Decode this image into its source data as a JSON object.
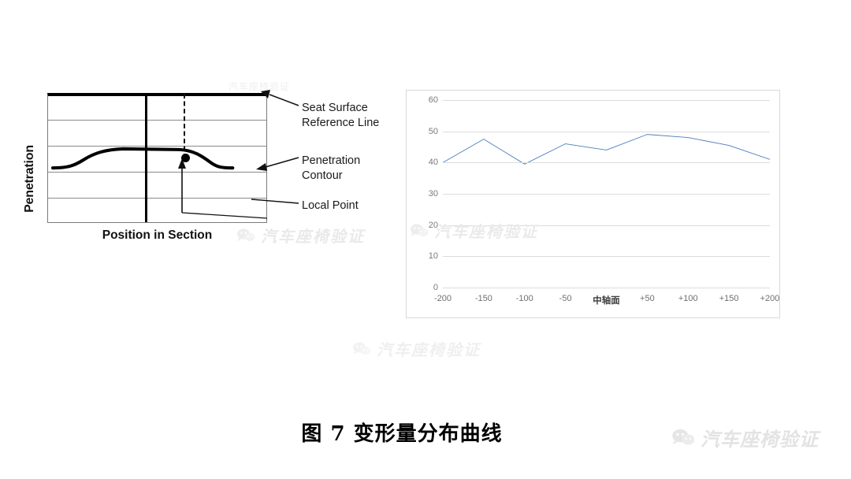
{
  "left_figure": {
    "y_axis_label": "Penetration",
    "x_axis_label": "Position in Section",
    "annotations": {
      "seat_surface": "Seat Surface\nReference Line",
      "penetration_contour": "Penetration\nContour",
      "local_point": "Local Point"
    },
    "faint_top_text": "汽车座椅验证"
  },
  "chart_data": {
    "type": "line",
    "title": "",
    "xlabel": "",
    "ylabel": "",
    "categories": [
      "-200",
      "-150",
      "-100",
      "-50",
      "中轴面",
      "+50",
      "+100",
      "+150",
      "+200"
    ],
    "values": [
      40,
      47.5,
      39.5,
      46,
      44,
      49,
      48,
      45.5,
      41
    ],
    "series": [
      {
        "name": "变形量",
        "values": [
          40,
          47.5,
          39.5,
          46,
          44,
          49,
          48,
          45.5,
          41
        ]
      }
    ],
    "y_ticks": [
      0,
      10,
      20,
      30,
      40,
      50,
      60
    ],
    "y_tick_labels": [
      "0",
      "10",
      "20",
      "30",
      "40",
      "50",
      "60"
    ],
    "ylim": [
      0,
      60
    ],
    "grid": true,
    "legend": "none",
    "line_color": "#4a7ebb",
    "grid_color": "#dcdcdc",
    "border_color": "#d9d9d9"
  },
  "caption": "图 7 变形量分布曲线",
  "watermarks": {
    "text": "汽车座椅验证",
    "icon": "wechat-icon"
  }
}
